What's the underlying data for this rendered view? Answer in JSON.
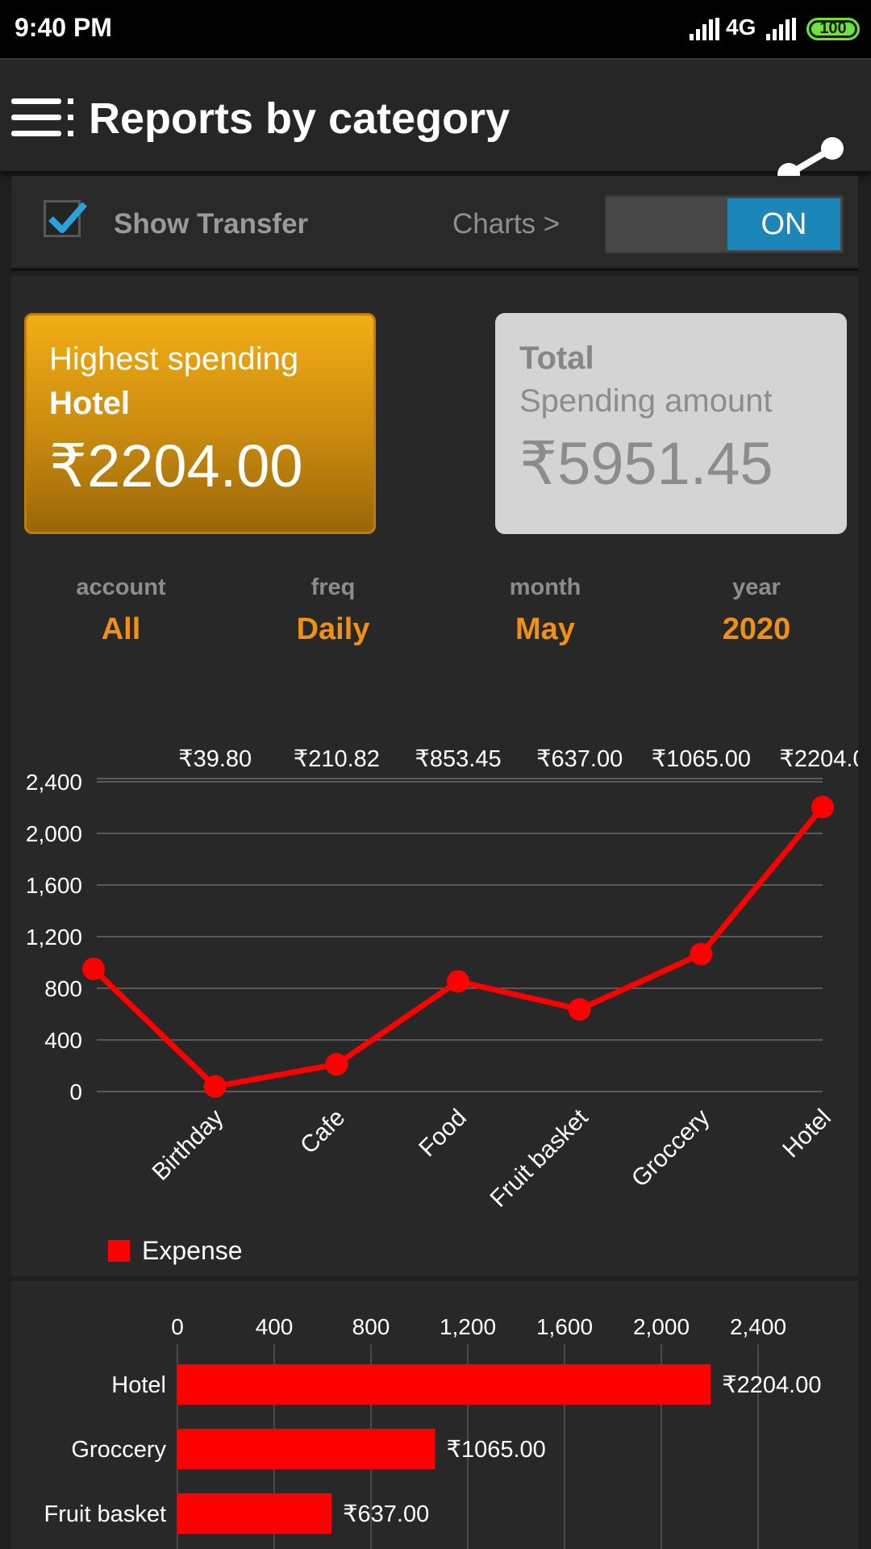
{
  "status_bar": {
    "time": "9:40 PM",
    "network": "4G",
    "battery": "100",
    "colors": {
      "battery": "#6fe33c"
    }
  },
  "app_bar": {
    "title": "Reports by category",
    "menu_icon": "menu-icon",
    "share_icon": "share-icon"
  },
  "options": {
    "show_transfer_label": "Show Transfer",
    "show_transfer_checked": true,
    "charts_link": "Charts >",
    "toggle_label": "ON",
    "colors": {
      "toggle_on": "#1b87b8",
      "check": "#29a3df"
    }
  },
  "highest_card": {
    "line1": "Highest spending",
    "category": "Hotel",
    "amount": "₹2204.00",
    "colors": {
      "top": "#f2ad16",
      "bottom": "#9a6708"
    }
  },
  "total_card": {
    "line1": "Total",
    "line2": "Spending amount",
    "amount": "₹5951.45"
  },
  "filters": [
    {
      "key": "account",
      "value": "All"
    },
    {
      "key": "freq",
      "value": "Daily"
    },
    {
      "key": "month",
      "value": "May"
    },
    {
      "key": "year",
      "value": "2020"
    }
  ],
  "accent_color": "#f09015",
  "chart_data": [
    {
      "type": "line",
      "x": [
        "",
        "Birthday",
        "Cafe",
        "Food",
        "Fruit basket",
        "Groccery",
        "Hotel"
      ],
      "series": [
        {
          "name": "Expense",
          "values": [
            950,
            39.8,
            210.82,
            853.45,
            637.0,
            1065.0,
            2204.0
          ],
          "color": "#ff0000"
        }
      ],
      "data_labels": [
        "₹39.80",
        "₹210.82",
        "₹853.45",
        "₹637.00",
        "₹1065.00",
        "₹2204.0"
      ],
      "yticks": [
        "0",
        "400",
        "800",
        "1,200",
        "1,600",
        "2,000",
        "2,400"
      ],
      "ylim": [
        0,
        2400
      ],
      "grid": true,
      "legend": "bottom-left"
    },
    {
      "type": "bar",
      "orientation": "horizontal",
      "categories": [
        "Hotel",
        "Groccery",
        "Fruit basket"
      ],
      "values": [
        2204.0,
        1065.0,
        637.0
      ],
      "data_labels": [
        "₹2204.00",
        "₹1065.00",
        "₹637.00"
      ],
      "xticks": [
        "0",
        "400",
        "800",
        "1,200",
        "1,600",
        "2,000",
        "2,400"
      ],
      "xlim": [
        0,
        2400
      ],
      "grid": true,
      "color": "#ff0000"
    }
  ]
}
